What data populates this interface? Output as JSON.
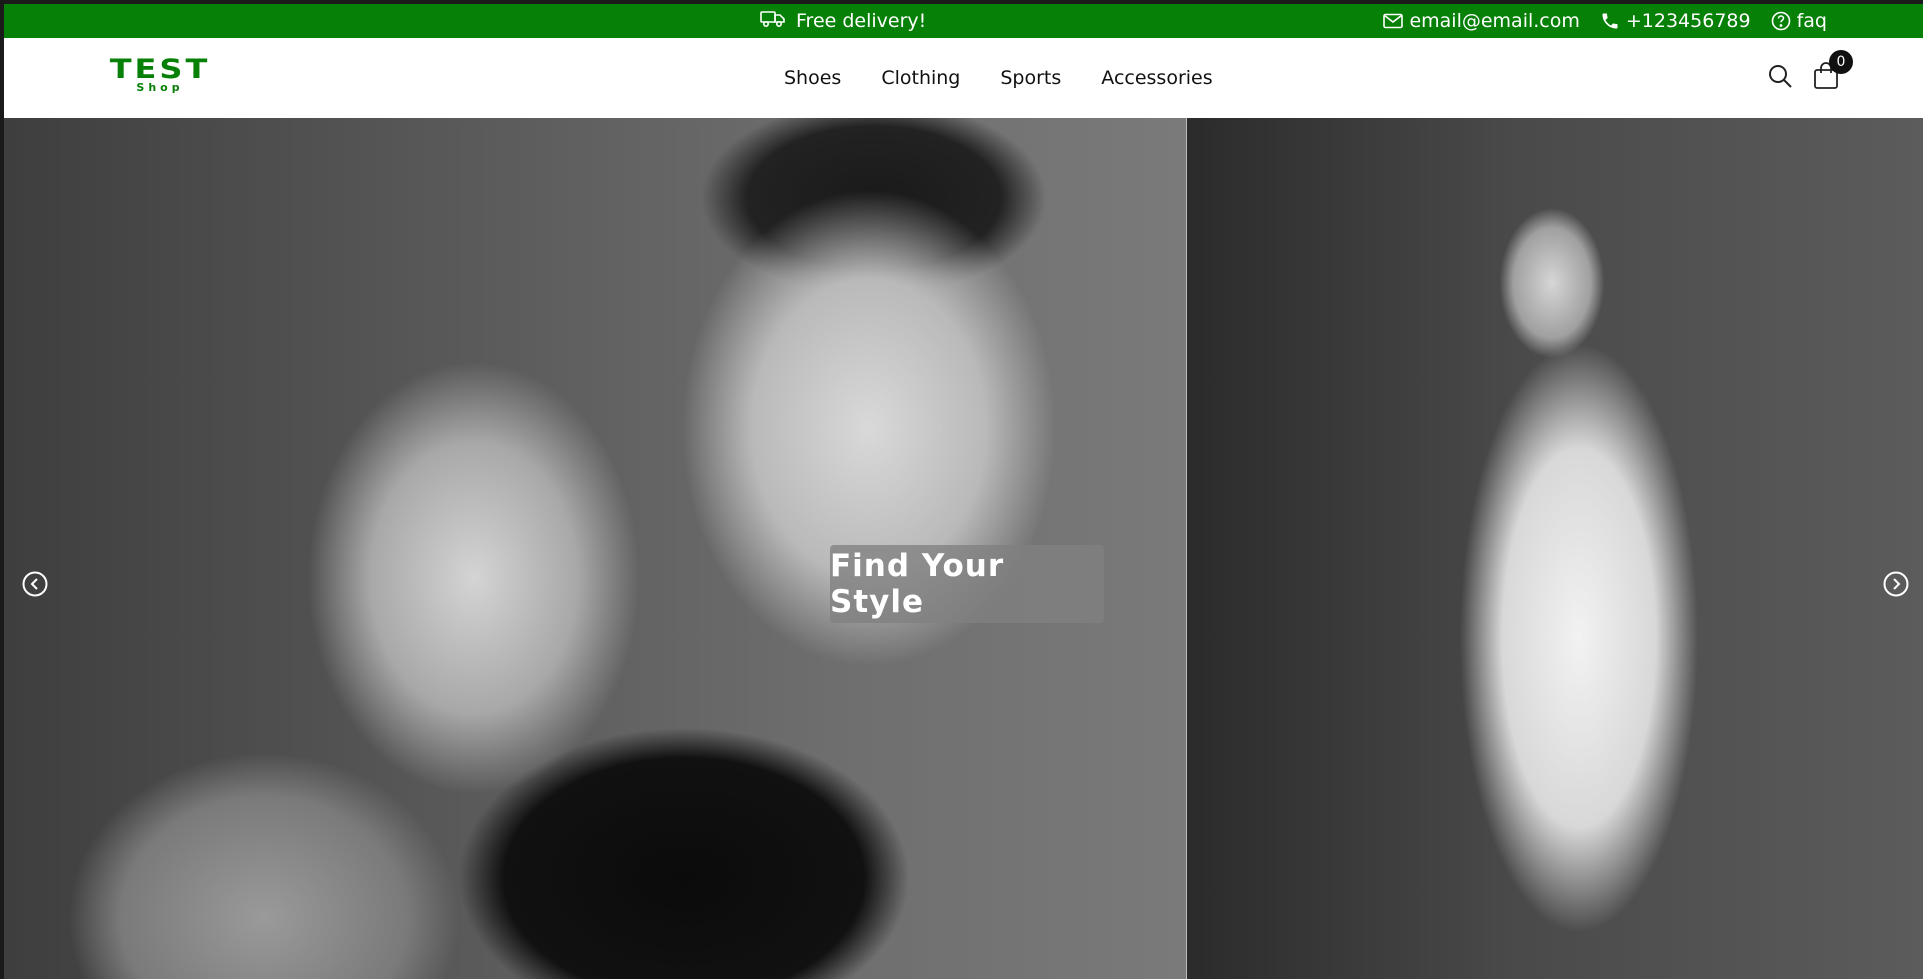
{
  "topbar": {
    "delivery_text": "Free delivery!",
    "email": "email@email.com",
    "phone": "+123456789",
    "faq": "faq"
  },
  "header": {
    "logo_main": "TEST",
    "logo_sub": "Shop",
    "nav": [
      "Shoes",
      "Clothing",
      "Sports",
      "Accessories"
    ],
    "cart_count": "0"
  },
  "hero": {
    "title": "Find Your Style"
  },
  "colors": {
    "brand_green": "#068006",
    "badge": "#111111",
    "overlay": "#808080"
  },
  "icons": {
    "delivery": "truck-icon",
    "email": "envelope-icon",
    "phone": "phone-icon",
    "faq": "question-circle-icon",
    "search": "search-icon",
    "cart": "shopping-bag-icon",
    "prev": "chevron-left-circle-icon",
    "next": "chevron-right-circle-icon"
  }
}
